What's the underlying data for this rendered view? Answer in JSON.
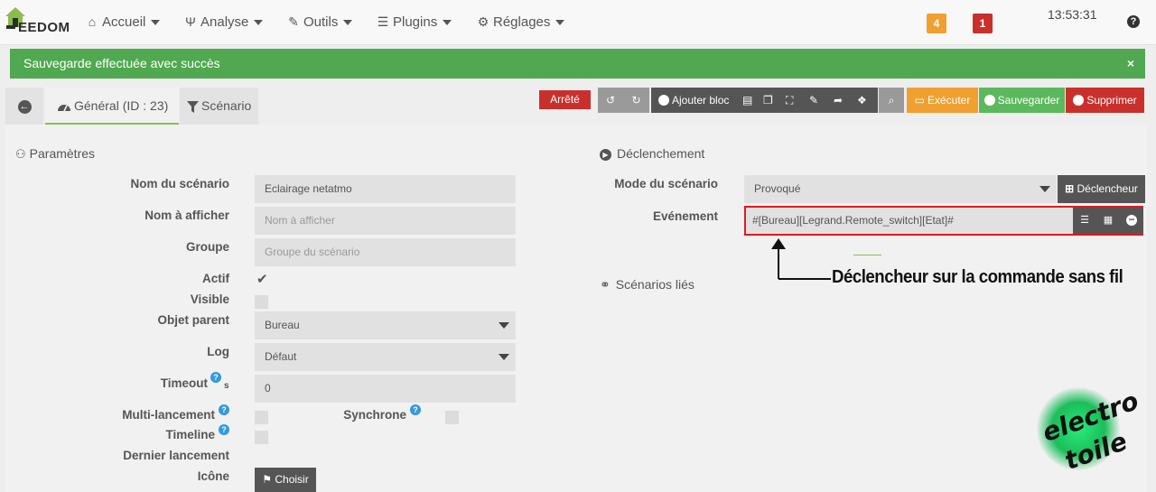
{
  "navbar": {
    "logo_text": "EEDOM",
    "items": [
      {
        "label": "Accueil",
        "icon": "home-icon"
      },
      {
        "label": "Analyse",
        "icon": "stethoscope-icon"
      },
      {
        "label": "Outils",
        "icon": "wrench-icon"
      },
      {
        "label": "Plugins",
        "icon": "list-icon"
      },
      {
        "label": "Réglages",
        "icon": "gear-icon"
      }
    ],
    "badge_warning": "4",
    "badge_danger": "1",
    "clock": "13:53:31",
    "colors": {
      "warning": "#f0a030",
      "danger": "#c9302c"
    }
  },
  "alert": {
    "message": "Sauvegarde effectuée avec succès",
    "close": "×",
    "color": "#50a850"
  },
  "tabs": {
    "general": "Général (ID : 23)",
    "scenario": "Scénario"
  },
  "toolbar": {
    "status": "Arrêté",
    "add_block": "Ajouter bloc",
    "execute": "Exécuter",
    "save": "Sauvegarder",
    "delete": "Supprimer"
  },
  "params": {
    "title": "Paramètres",
    "fields": {
      "name_label": "Nom du scénario",
      "name_value": "Eclairage netatmo",
      "display_label": "Nom à afficher",
      "display_placeholder": "Nom à afficher",
      "group_label": "Groupe",
      "group_placeholder": "Groupe du scénario",
      "active_label": "Actif",
      "active_checked": true,
      "visible_label": "Visible",
      "visible_checked": false,
      "parent_label": "Objet parent",
      "parent_value": "Bureau",
      "log_label": "Log",
      "log_value": "Défaut",
      "timeout_label": "Timeout",
      "timeout_unit": "s",
      "timeout_value": "0",
      "multi_label": "Multi-lancement",
      "sync_label": "Synchrone",
      "timeline_label": "Timeline",
      "last_run_label": "Dernier lancement",
      "icon_label": "Icône",
      "choose_button": "Choisir"
    }
  },
  "trigger": {
    "title": "Déclenchement",
    "mode_label": "Mode du scénario",
    "mode_value": "Provoqué",
    "trigger_button": "Déclencheur",
    "event_label": "Evénement",
    "event_value": "#[Bureau][Legrand.Remote_switch][Etat]#"
  },
  "linked": {
    "title": "Scénarios liés"
  },
  "annotation": {
    "text": "Déclencheur sur la commande sans fil",
    "highlight_color": "#e0191e"
  },
  "watermark": {
    "line1": "electro",
    "line2": "toile"
  }
}
